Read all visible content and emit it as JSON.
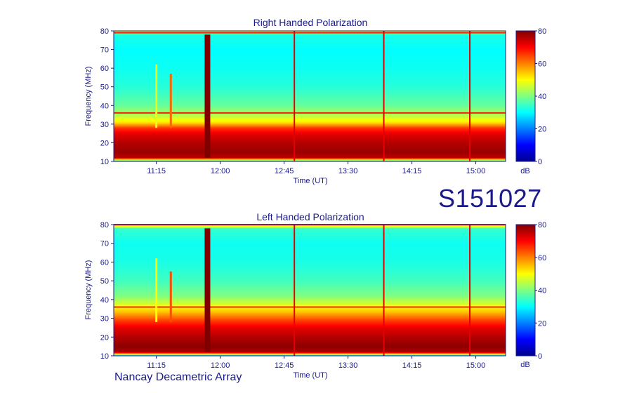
{
  "figure_id": "S151027",
  "footer": "Nancay Decametric Array",
  "colors": {
    "label_text": "#1a1a8c",
    "axis": "#1a1a8c",
    "colormap": [
      "#00008f",
      "#0000ff",
      "#0080ff",
      "#00ffff",
      "#80ff80",
      "#ffff00",
      "#ff8000",
      "#ff0000",
      "#800000"
    ]
  },
  "chart_data": [
    {
      "type": "heatmap",
      "title": "Right Handed Polarization",
      "xlabel": "Time (UT)",
      "ylabel": "Frequency (MHz)",
      "x_ticks": [
        "11:15",
        "12:00",
        "12:45",
        "13:30",
        "14:15",
        "15:00"
      ],
      "x_tick_hours": [
        11.25,
        12.0,
        12.75,
        13.5,
        14.25,
        15.0
      ],
      "x_range_hours": [
        10.75,
        15.35
      ],
      "y_ticks": [
        10,
        20,
        30,
        40,
        50,
        60,
        70,
        80
      ],
      "ylim": [
        10,
        80
      ],
      "colorbar": {
        "label": "dB",
        "range": [
          0,
          80
        ],
        "ticks": [
          0,
          20,
          40,
          60,
          80
        ]
      },
      "frequency_profile_db": [
        {
          "freq": 10,
          "db": 22
        },
        {
          "freq": 12,
          "db": 75
        },
        {
          "freq": 15,
          "db": 78
        },
        {
          "freq": 20,
          "db": 76
        },
        {
          "freq": 25,
          "db": 72
        },
        {
          "freq": 28,
          "db": 66
        },
        {
          "freq": 31,
          "db": 52
        },
        {
          "freq": 35,
          "db": 44
        },
        {
          "freq": 40,
          "db": 38
        },
        {
          "freq": 50,
          "db": 33
        },
        {
          "freq": 60,
          "db": 31
        },
        {
          "freq": 70,
          "db": 30
        },
        {
          "freq": 78,
          "db": 32
        },
        {
          "freq": 80,
          "db": 50
        }
      ],
      "burst_events": [
        {
          "time_hours": 11.85,
          "freq_min": 12,
          "freq_max": 78,
          "db": 80
        },
        {
          "time_hours": 11.42,
          "freq_min": 28,
          "freq_max": 57,
          "db": 62
        },
        {
          "time_hours": 11.25,
          "freq_min": 28,
          "freq_max": 62,
          "db": 48
        }
      ],
      "vertical_lines_hours": [
        12.87,
        13.92,
        14.93
      ],
      "horizontal_lines_mhz": [
        36,
        79
      ]
    },
    {
      "type": "heatmap",
      "title": "Left Handed Polarization",
      "xlabel": "Time (UT)",
      "ylabel": "Frequency (MHz)",
      "x_ticks": [
        "11:15",
        "12:00",
        "12:45",
        "13:30",
        "14:15",
        "15:00"
      ],
      "x_tick_hours": [
        11.25,
        12.0,
        12.75,
        13.5,
        14.25,
        15.0
      ],
      "x_range_hours": [
        10.75,
        15.35
      ],
      "y_ticks": [
        10,
        20,
        30,
        40,
        50,
        60,
        70,
        80
      ],
      "ylim": [
        10,
        80
      ],
      "colorbar": {
        "label": "dB",
        "range": [
          0,
          80
        ],
        "ticks": [
          0,
          20,
          40,
          60,
          80
        ]
      },
      "frequency_profile_db": [
        {
          "freq": 10,
          "db": 25
        },
        {
          "freq": 12,
          "db": 76
        },
        {
          "freq": 15,
          "db": 79
        },
        {
          "freq": 20,
          "db": 76
        },
        {
          "freq": 25,
          "db": 72
        },
        {
          "freq": 29,
          "db": 65
        },
        {
          "freq": 33,
          "db": 56
        },
        {
          "freq": 37,
          "db": 48
        },
        {
          "freq": 42,
          "db": 40
        },
        {
          "freq": 50,
          "db": 35
        },
        {
          "freq": 60,
          "db": 32
        },
        {
          "freq": 70,
          "db": 31
        },
        {
          "freq": 78,
          "db": 34
        },
        {
          "freq": 80,
          "db": 60
        }
      ],
      "burst_events": [
        {
          "time_hours": 11.85,
          "freq_min": 12,
          "freq_max": 78,
          "db": 80
        },
        {
          "time_hours": 11.42,
          "freq_min": 28,
          "freq_max": 55,
          "db": 64
        },
        {
          "time_hours": 11.25,
          "freq_min": 28,
          "freq_max": 62,
          "db": 50
        }
      ],
      "vertical_lines_hours": [
        12.87,
        13.92,
        14.93
      ],
      "horizontal_lines_mhz": [
        36,
        80
      ]
    }
  ]
}
